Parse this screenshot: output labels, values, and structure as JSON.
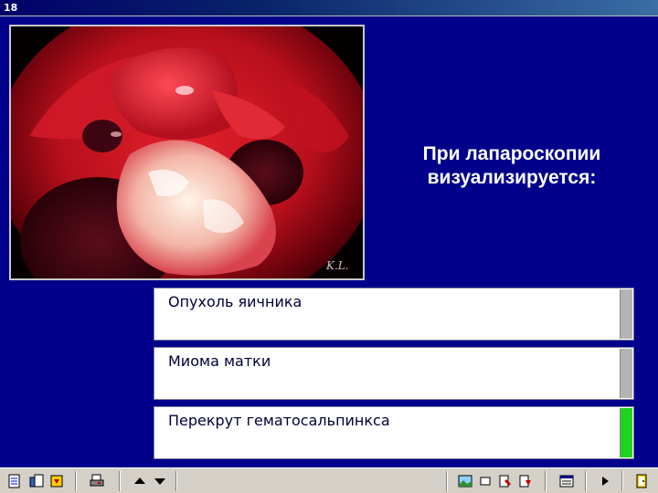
{
  "window": {
    "slide_number": "18"
  },
  "slide": {
    "question": "При лапароскопии визуализируется:",
    "photo_alt": "laparoscopy-photo",
    "answers": [
      {
        "label": "Опухоль яичника",
        "state": "neutral"
      },
      {
        "label": "Миома матки",
        "state": "neutral"
      },
      {
        "label": "Перекрут гематосальпинкса",
        "state": "correct"
      }
    ]
  },
  "colors": {
    "slide_background": "#00008b",
    "indicator_neutral": "#b4b4b4",
    "indicator_correct": "#1fd31f"
  },
  "toolbar": {
    "icons": [
      "notes-icon",
      "clipboard-icon",
      "download-icon",
      "print-icon",
      "arrow-up-icon",
      "arrow-down-icon",
      "picture-icon",
      "window-icon",
      "edit-icon",
      "bookmark-icon",
      "calendar-icon",
      "play-icon",
      "exit-icon"
    ]
  }
}
